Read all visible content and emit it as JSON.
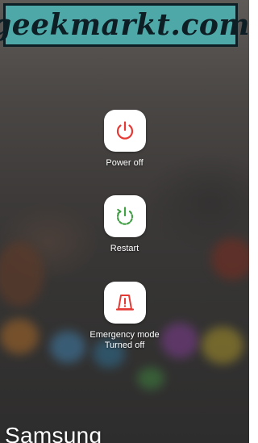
{
  "watermark": {
    "text": "geekmarkt.com"
  },
  "power_menu": {
    "power_off": {
      "label": "Power off",
      "icon": "power-icon",
      "color": "#e53935"
    },
    "restart": {
      "label": "Restart",
      "icon": "restart-icon",
      "color": "#43a047"
    },
    "emergency": {
      "label": "Emergency mode",
      "status": "Turned off",
      "icon": "emergency-icon",
      "color": "#e53935"
    }
  },
  "device": {
    "brand": "Samsung"
  },
  "colors": {
    "watermark_bg": "#4ea8a8",
    "watermark_text": "#0d1e25"
  }
}
